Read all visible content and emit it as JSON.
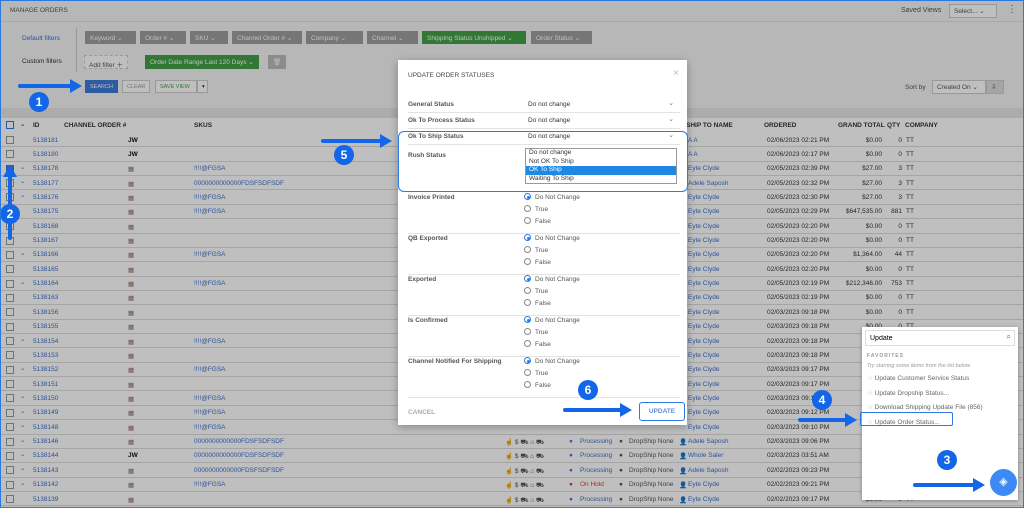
{
  "header": {
    "title": "MANAGE ORDERS",
    "saved_views_label": "Saved Views",
    "saved_views_value": "Select...",
    "more_icon": "kebab-icon"
  },
  "filters": {
    "default_label": "Default filters",
    "custom_label": "Custom filters",
    "chips": [
      "Keyword",
      "Order #",
      "SKU",
      "Channel Order #",
      "Company",
      "Channel",
      "Shipping Status Unshipped",
      "Order Status"
    ],
    "add_filter": "Add filter",
    "date_chip": "Order Date Range Last 120 Days",
    "search": "SEARCH",
    "clear": "CLEAR",
    "save_view": "SAVE VIEW",
    "sort_by_label": "Sort by",
    "sort_by_value": "Created On"
  },
  "table": {
    "columns": {
      "id": "ID",
      "channel_order": "CHANNEL ORDER #",
      "skus": "SKUS",
      "ship_to": "SHIP TO NAME",
      "ordered": "ORDERED",
      "grand_total": "GRAND TOTAL",
      "qty": "QTY",
      "company": "COMPANY"
    },
    "rows": [
      {
        "id": "5138181",
        "channel": "JW",
        "sku": "",
        "ship_to": "A A",
        "ordered": "02/06/2023 02:21 PM",
        "total": "$0.00",
        "qty": "0",
        "company": "TT",
        "expand": false,
        "checked": false
      },
      {
        "id": "5138180",
        "channel": "JW",
        "sku": "",
        "ship_to": "A A",
        "ordered": "02/06/2023 02:17 PM",
        "total": "$0.00",
        "qty": "0",
        "company": "TT",
        "expand": false,
        "checked": false
      },
      {
        "id": "5138178",
        "channel": "store",
        "sku": "!!!!@FGSA",
        "ship_to": "Eyte Clyde",
        "ordered": "02/05/2023 02:39 PM",
        "total": "$27.00",
        "qty": "3",
        "company": "TT",
        "expand": true,
        "checked": true
      },
      {
        "id": "5138177",
        "channel": "store",
        "sku": "0000000000000FDSFSDFSDF",
        "ship_to": "Adele Saposh",
        "ordered": "02/05/2023 02:32 PM",
        "total": "$27.00",
        "qty": "3",
        "company": "TT",
        "expand": true,
        "checked": false
      },
      {
        "id": "5138176",
        "channel": "store",
        "sku": "!!!!@FGSA",
        "ship_to": "Eyte Clyde",
        "ordered": "02/05/2023 02:30 PM",
        "total": "$27.00",
        "qty": "3",
        "company": "TT",
        "expand": true,
        "checked": false
      },
      {
        "id": "5138175",
        "channel": "store",
        "sku": "!!!!@FGSA",
        "ship_to": "Eyte Clyde",
        "ordered": "02/05/2023 02:29 PM",
        "total": "$647,535.00",
        "qty": "881",
        "company": "TT",
        "expand": false,
        "checked": false
      },
      {
        "id": "5138168",
        "channel": "store",
        "sku": "",
        "ship_to": "Eyte Clyde",
        "ordered": "02/05/2023 02:20 PM",
        "total": "$0.00",
        "qty": "0",
        "company": "TT",
        "expand": false,
        "checked": false
      },
      {
        "id": "5138167",
        "channel": "store",
        "sku": "",
        "ship_to": "Eyte Clyde",
        "ordered": "02/05/2023 02:20 PM",
        "total": "$0.00",
        "qty": "0",
        "company": "TT",
        "expand": false,
        "checked": false
      },
      {
        "id": "5138166",
        "channel": "store",
        "sku": "!!!!@FGSA",
        "ship_to": "Eyte Clyde",
        "ordered": "02/05/2023 02:20 PM",
        "total": "$1,364.00",
        "qty": "44",
        "company": "TT",
        "expand": true,
        "checked": false
      },
      {
        "id": "5138165",
        "channel": "store",
        "sku": "",
        "ship_to": "Eyte Clyde",
        "ordered": "02/05/2023 02:20 PM",
        "total": "$0.00",
        "qty": "0",
        "company": "TT",
        "expand": false,
        "checked": false
      },
      {
        "id": "5138164",
        "channel": "store",
        "sku": "!!!!@FGSA",
        "ship_to": "Eyte Clyde",
        "ordered": "02/05/2023 02:19 PM",
        "total": "$212,346.00",
        "qty": "753",
        "company": "TT",
        "expand": true,
        "checked": false
      },
      {
        "id": "5138163",
        "channel": "store",
        "sku": "",
        "ship_to": "Eyte Clyde",
        "ordered": "02/05/2023 02:19 PM",
        "total": "$0.00",
        "qty": "0",
        "company": "TT",
        "expand": false,
        "checked": false
      },
      {
        "id": "5138156",
        "channel": "store",
        "sku": "",
        "ship_to": "Eyte Clyde",
        "ordered": "02/03/2023 09:18 PM",
        "total": "$0.00",
        "qty": "0",
        "company": "TT",
        "expand": false,
        "checked": false
      },
      {
        "id": "5138155",
        "channel": "store",
        "sku": "",
        "ship_to": "Eyte Clyde",
        "ordered": "02/03/2023 09:18 PM",
        "total": "$0.00",
        "qty": "0",
        "company": "TT",
        "expand": false,
        "checked": false
      },
      {
        "id": "5138154",
        "channel": "store",
        "sku": "!!!!@FGSA",
        "ship_to": "Eyte Clyde",
        "ordered": "02/03/2023 09:18 PM",
        "total": "$9,",
        "qty": "",
        "company": "",
        "expand": true,
        "checked": false
      },
      {
        "id": "5138153",
        "channel": "store",
        "sku": "",
        "ship_to": "Eyte Clyde",
        "ordered": "02/03/2023 09:18 PM",
        "total": "",
        "qty": "",
        "company": "",
        "expand": false,
        "checked": false
      },
      {
        "id": "5138152",
        "channel": "store",
        "sku": "!!!!@FGSA",
        "ship_to": "Eyte Clyde",
        "ordered": "02/03/2023 09:17 PM",
        "total": "$78,",
        "qty": "",
        "company": "",
        "expand": true,
        "checked": false
      },
      {
        "id": "5138151",
        "channel": "store",
        "sku": "",
        "ship_to": "Eyte Clyde",
        "ordered": "02/03/2023 09:17 PM",
        "total": "",
        "qty": "",
        "company": "",
        "expand": false,
        "checked": false
      },
      {
        "id": "5138150",
        "channel": "store",
        "sku": "!!!!@FGSA",
        "ship_to": "Eyte Clyde",
        "ordered": "02/03/2023 09:1",
        "total": "$51,",
        "qty": "",
        "company": "",
        "expand": true,
        "checked": false
      },
      {
        "id": "5138149",
        "channel": "store",
        "sku": "!!!!@FGSA",
        "ship_to": "Eyte Clyde",
        "ordered": "02/03/2023 09:12 PM",
        "total": "",
        "qty": "",
        "company": "",
        "expand": true,
        "checked": false
      },
      {
        "id": "5138148",
        "channel": "store",
        "sku": "!!!!@FGSA",
        "ship_to": "Eyte Clyde",
        "ordered": "02/03/2023 09:10 PM",
        "total": "",
        "qty": "",
        "company": "",
        "expand": true,
        "checked": false
      },
      {
        "id": "5138146",
        "channel": "store",
        "sku": "0000000000000FDSFSDFSDF",
        "ship_to": "Adele Saposh",
        "ordered": "02/03/2023 09:06 PM",
        "total": "",
        "qty": "",
        "company": "",
        "expand": true,
        "checked": false,
        "status": "Processing",
        "dropship": "DropShip None"
      },
      {
        "id": "5138144",
        "channel": "JW",
        "sku": "0000000000000FDSFSDFSDF",
        "ship_to": "Whole Saler",
        "ordered": "02/03/2023 03:51 AM",
        "total": "",
        "qty": "",
        "company": "",
        "expand": true,
        "checked": false,
        "status": "Processing",
        "dropship": "DropShip None"
      },
      {
        "id": "5138143",
        "channel": "store",
        "sku": "0000000000000FDSFSDFSDF",
        "ship_to": "Adele Saposh",
        "ordered": "02/02/2023 09:23 PM",
        "total": "",
        "qty": "",
        "company": "",
        "expand": true,
        "checked": false,
        "status": "Processing",
        "dropship": "DropShip None"
      },
      {
        "id": "5138142",
        "channel": "store",
        "sku": "!!!!@FGSA",
        "ship_to": "Eyte Clyde",
        "ordered": "02/02/2023 09:21 PM",
        "total": "$297,",
        "qty": "",
        "company": "",
        "expand": true,
        "checked": false,
        "status": "On Hold",
        "dropship": "DropShip None"
      },
      {
        "id": "5138139",
        "channel": "store",
        "sku": "",
        "ship_to": "Eyte Clyde",
        "ordered": "02/02/2023 09:17 PM",
        "total": "$0.00",
        "qty": "0",
        "company": "TT",
        "expand": false,
        "checked": false,
        "status": "Processing",
        "dropship": "DropShip None"
      }
    ]
  },
  "modal": {
    "title": "UPDATE ORDER STATUSES",
    "selects": [
      {
        "label": "General Status",
        "value": "Do not change"
      },
      {
        "label": "Ok To Process Status",
        "value": "Do not change"
      },
      {
        "label": "Ok To Ship Status",
        "value": "Do not change"
      },
      {
        "label": "Rush Status",
        "value": ""
      }
    ],
    "dropdown_options": [
      "Do not change",
      "Not OK To Ship",
      "OK To Ship",
      "Waiting To Ship"
    ],
    "dropdown_selected": "OK To Ship",
    "radio_groups": [
      {
        "label": "Invoice Printed",
        "options": [
          "Do Not Change",
          "True",
          "False"
        ],
        "selected": "Do Not Change"
      },
      {
        "label": "QB Exported",
        "options": [
          "Do Not Change",
          "True",
          "False"
        ],
        "selected": "Do Not Change"
      },
      {
        "label": "Exported",
        "options": [
          "Do Not Change",
          "True",
          "False"
        ],
        "selected": "Do Not Change"
      },
      {
        "label": "Is Confirmed",
        "options": [
          "Do Not Change",
          "True",
          "False"
        ],
        "selected": "Do Not Change"
      },
      {
        "label": "Channel Notified For Shipping",
        "options": [
          "Do Not Change",
          "True",
          "False"
        ],
        "selected": "Do Not Change"
      }
    ],
    "cancel": "CANCEL",
    "update": "UPDATE"
  },
  "action_popup": {
    "search_value": "Update",
    "favorites_label": "FAVORITES",
    "favorites_hint": "Try starring some items from the list below.",
    "items": [
      "Update Customer Service Status",
      "Update Dropship Status...",
      "Download Shipping Update File (856)",
      "Update Order Status..."
    ]
  },
  "annotations": [
    "1",
    "2",
    "3",
    "4",
    "5",
    "6"
  ],
  "colors": {
    "accent": "#2a7ae2",
    "green": "#43a047",
    "link": "#3b6fd0",
    "on_hold": "#e53935"
  }
}
